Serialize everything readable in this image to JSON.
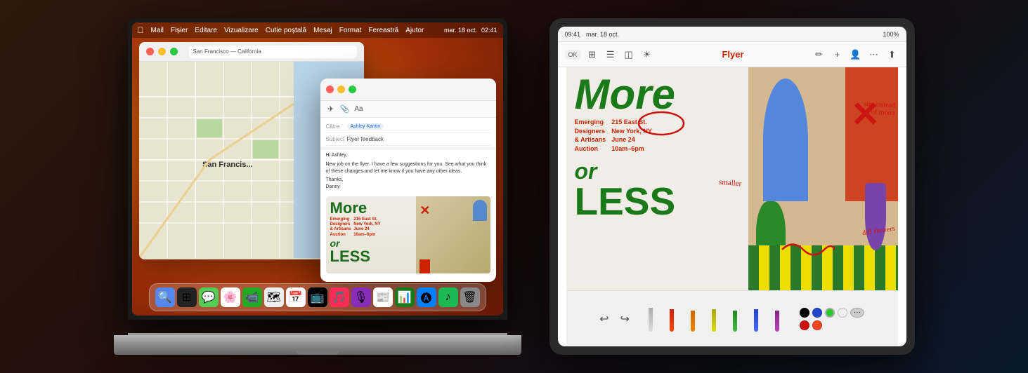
{
  "scene": {
    "bg_color": "#1a1a1a"
  },
  "macbook": {
    "menu_bar": {
      "apple": "🍎",
      "items": [
        "Mail",
        "Fișier",
        "Editare",
        "Vizualizare",
        "Cutie poștală",
        "Mesaj",
        "Format",
        "Fereastră",
        "Ajutor"
      ],
      "status": [
        "mar. 18 oct.",
        "02:41"
      ]
    },
    "maps_window": {
      "title": "San Francisco — California",
      "map_label": "San Francis..."
    },
    "mail_window": {
      "from_label": "Către",
      "from_value": "Ashley Kantin",
      "subject_label": "Subiect",
      "subject_value": "Flyer feedback",
      "body": "Hi Ashley,\n\nNew job on the flyer. I have a few suggestions for you. See what you think of these changes and let me know if you have any other ideas.\n\nThanks,\nDanny"
    },
    "dock_icons": [
      "🔍",
      "📁",
      "📱",
      "💬",
      "📸",
      "🎵",
      "📺",
      "🎵",
      "📰",
      "📊",
      "📱",
      "🎵",
      "🗑️"
    ]
  },
  "ipad": {
    "status_bar": {
      "time": "09:41",
      "date": "mar. 18 oct.",
      "battery": "100%"
    },
    "toolbar": {
      "ok_label": "OK",
      "doc_title": "Flyer",
      "undo_label": "↩",
      "redo_label": "↪"
    },
    "flyer": {
      "more_text": "More",
      "or_text": "or",
      "less_text": "LESS",
      "event_name": "Emerging Designers & Artisans Auction",
      "address": "215 East St. New York, NY",
      "date": "June 24",
      "time": "10am–6pm",
      "annotation_smaller": "smaller",
      "annotation_sun": "sun instead of moon",
      "annotation_flowers": "diff flowers",
      "annotation_circle_text": ""
    },
    "pencil_toolbar": {
      "tools": [
        "pencil",
        "pen",
        "brush",
        "marker",
        "eraser"
      ],
      "colors": [
        "#000000",
        "#1a6ee0",
        "#2db82d",
        "#cc2200",
        "#ff6600",
        "#ee1111",
        "#cc00cc"
      ],
      "color_swatches": [
        "#000000",
        "#2244cc",
        "#22aa22",
        "#dddddd",
        "#eeaa00"
      ]
    }
  }
}
